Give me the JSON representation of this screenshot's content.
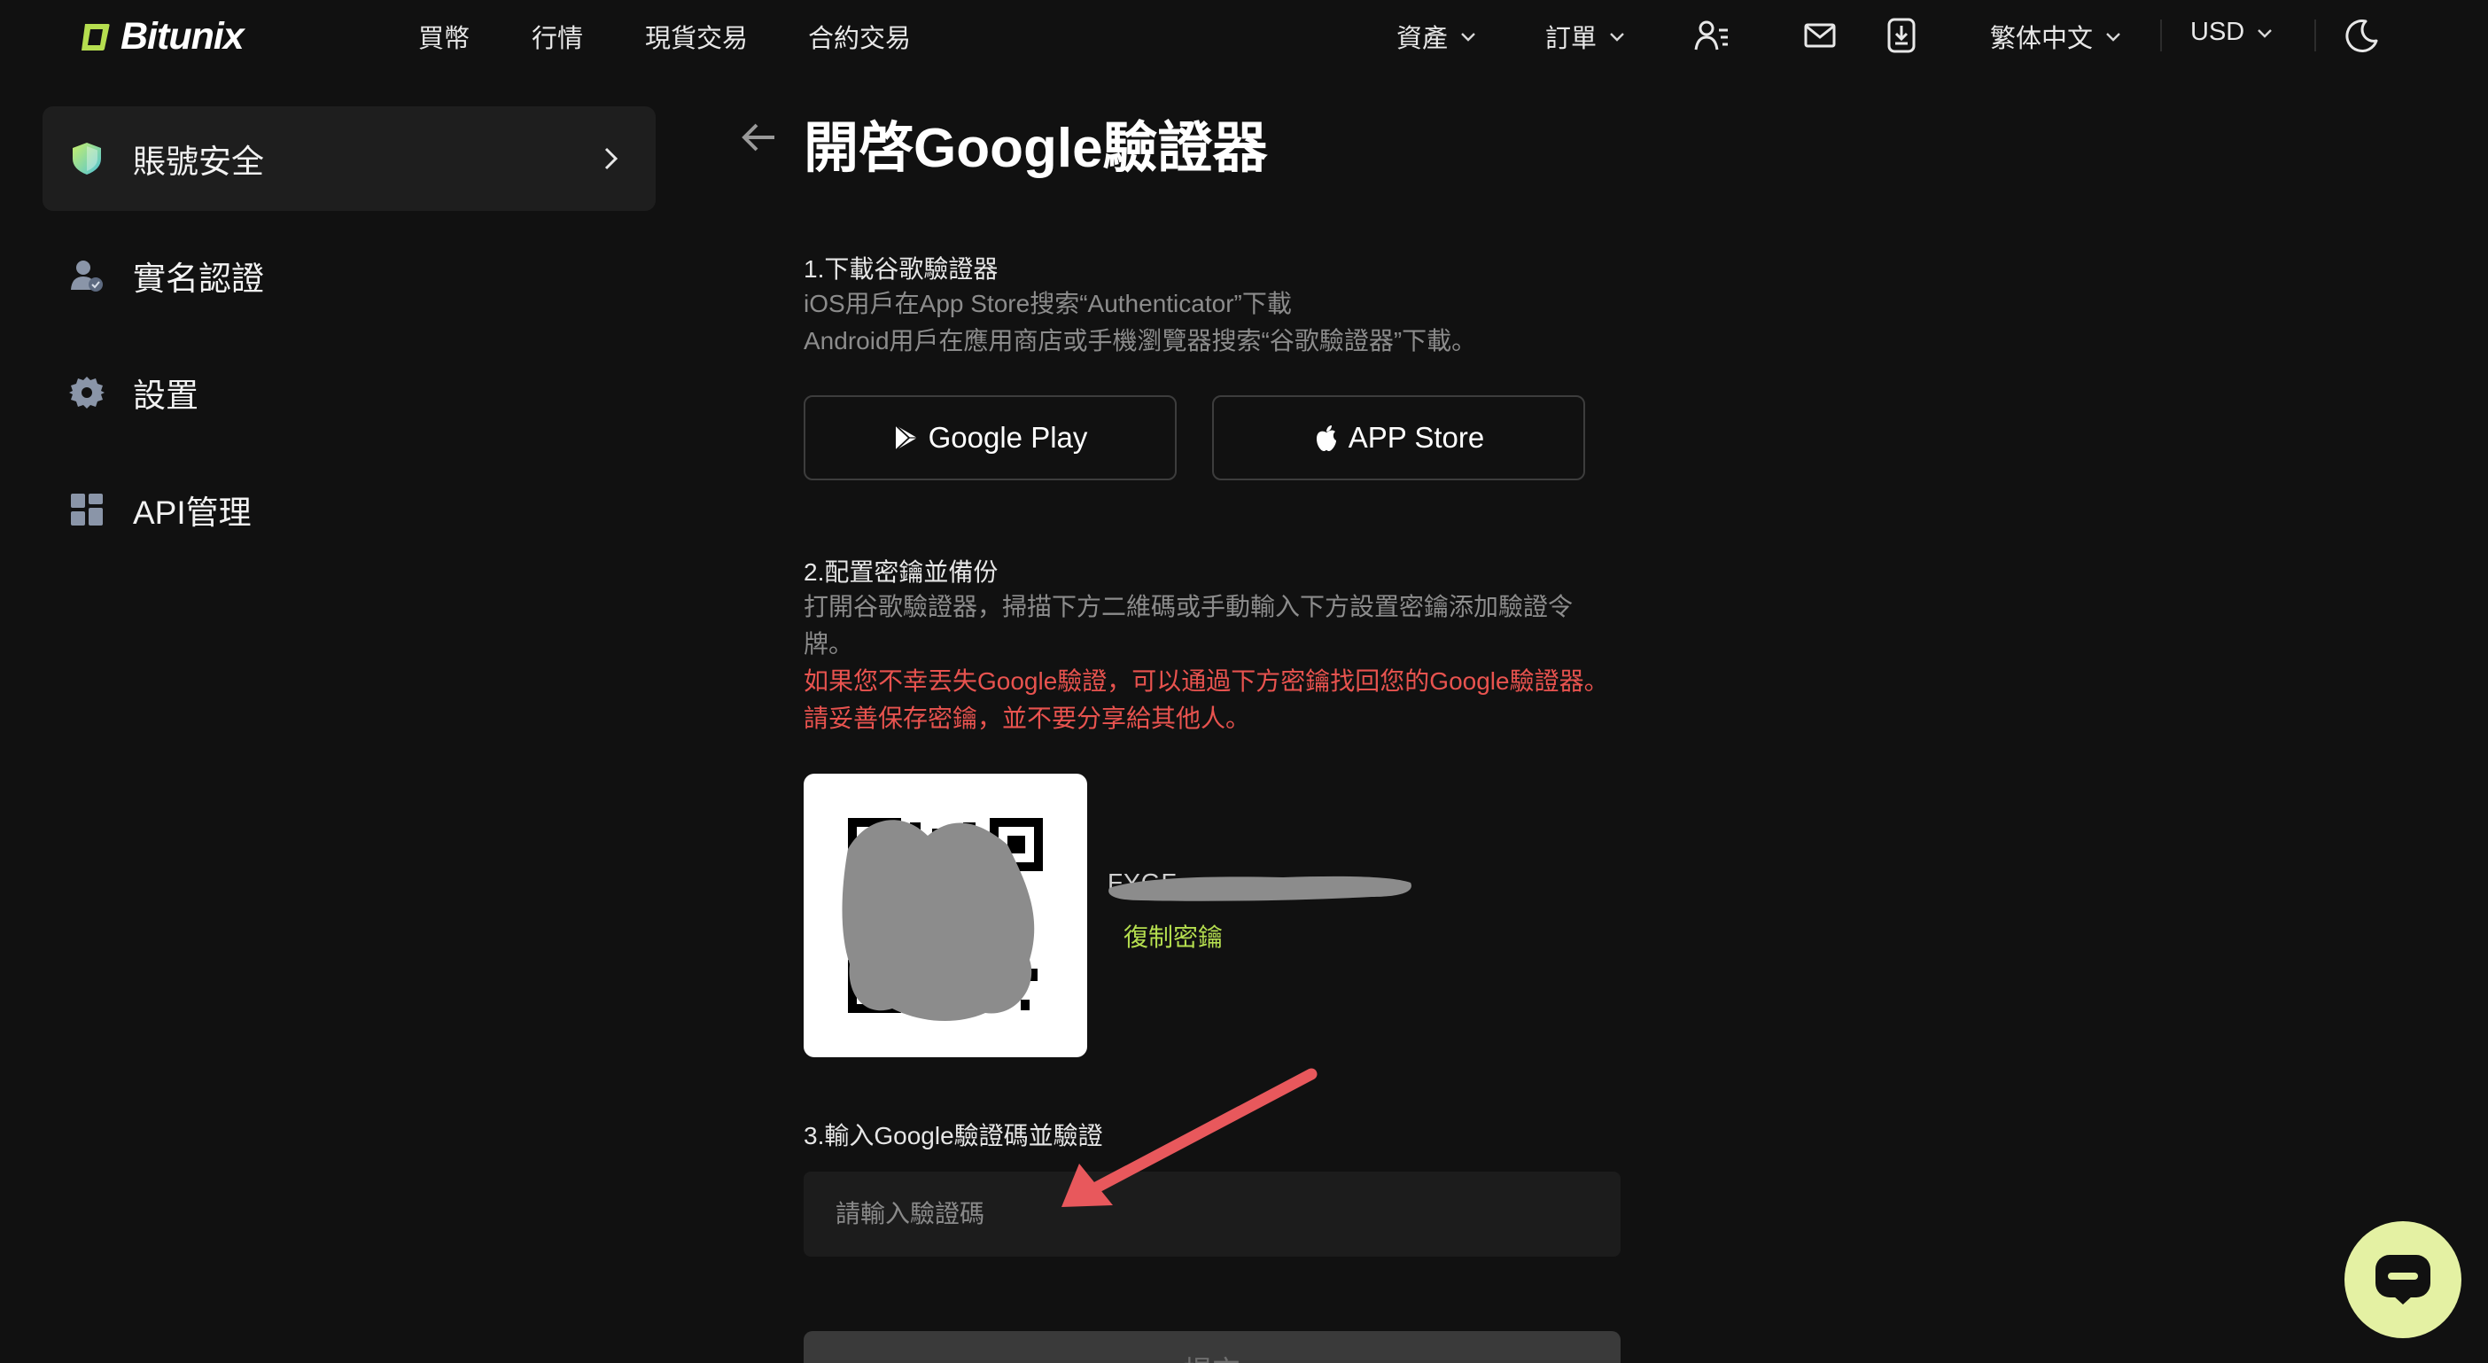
{
  "brand": {
    "name": "Bitunix",
    "accent": "#b5de4f"
  },
  "nav": {
    "links": [
      "買幣",
      "行情",
      "現貨交易",
      "合約交易"
    ],
    "assets": "資產",
    "orders": "訂單",
    "language": "繁体中文",
    "currency": "USD"
  },
  "sidebar": {
    "items": [
      {
        "label": "賬號安全",
        "icon": "shield-icon"
      },
      {
        "label": "實名認證",
        "icon": "user-verified-icon"
      },
      {
        "label": "設置",
        "icon": "gear-icon"
      },
      {
        "label": "API管理",
        "icon": "grid-icon"
      }
    ]
  },
  "page": {
    "title": "開啓Google驗證器",
    "step1": {
      "title": "1.下載谷歌驗證器",
      "ios": "iOS用戶在App Store搜索“Authenticator”下載",
      "android": "Android用戶在應用商店或手機瀏覽器搜索“谷歌驗證器”下載。"
    },
    "google_play": "Google Play",
    "app_store": "APP Store",
    "step2": {
      "title": "2.配置密鑰並備份",
      "desc": "打開谷歌驗證器，掃描下方二維碼或手動輸入下方設置密鑰添加驗證令牌。",
      "warn1": "如果您不幸丟失Google驗證，可以通過下方密鑰找回您的Google驗證器。",
      "warn2": "請妥善保存密鑰，並不要分享給其他人。"
    },
    "secret_fragment": "FYGF",
    "copy_key": "復制密鑰",
    "step3": {
      "title": "3.輸入Google驗證碼並驗證",
      "placeholder": "請輸入驗證碼"
    },
    "submit": "提交"
  },
  "annotation_color": "#e8585c",
  "chat": {
    "icon": "chat-icon",
    "color": "#e4f1a3"
  }
}
